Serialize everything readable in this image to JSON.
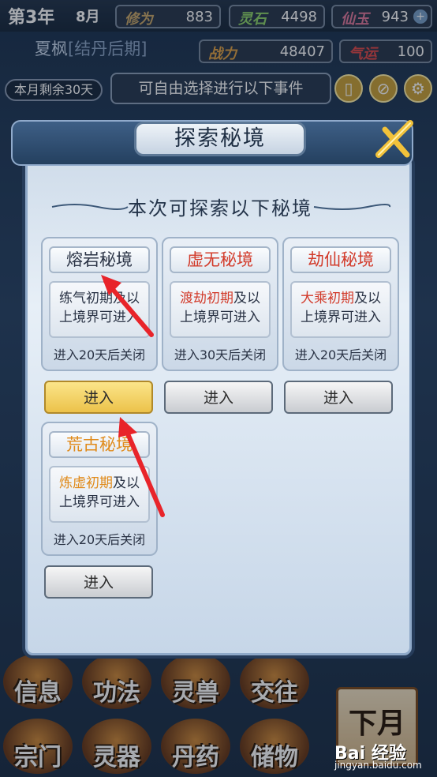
{
  "status": {
    "year": "第3年",
    "month": "8月",
    "cultivation": {
      "label": "修为",
      "value": "883",
      "color": "#c9a86a"
    },
    "spirit_stone": {
      "label": "灵石",
      "value": "4498",
      "color": "#8fd46a"
    },
    "jade": {
      "label": "仙玉",
      "value": "943",
      "color": "#e07a9c"
    },
    "power": {
      "label": "战力",
      "value": "48407",
      "color": "#e0a246"
    },
    "luck": {
      "label": "气运",
      "value": "100",
      "color": "#e04a4a"
    }
  },
  "player": {
    "name": "夏枫",
    "realm": "结丹后期"
  },
  "days_left": "本月剩余30天",
  "event_hint": "可自由选择进行以下事件",
  "dialog": {
    "title": "探索秘境",
    "subtitle": "本次可探索以下秘境",
    "realms": [
      {
        "name": "熔岩秘境",
        "name_color": "#2a3345",
        "req_highlight": "",
        "req_plain": "练气初期及以上境界可进入",
        "close_note": "进入20天后关闭",
        "enter_label": "进入",
        "enter_style": "gold"
      },
      {
        "name": "虚无秘境",
        "name_color": "#d23b2b",
        "req_highlight": "渡劫初期",
        "req_rest": "及以上境界可进入",
        "highlight_color": "#d23b2b",
        "close_note": "进入30天后关闭",
        "enter_label": "进入",
        "enter_style": "gray"
      },
      {
        "name": "劫仙秘境",
        "name_color": "#d23b2b",
        "req_highlight": "大乘初期",
        "req_rest": "及以上境界可进入",
        "highlight_color": "#d23b2b",
        "close_note": "进入20天后关闭",
        "enter_label": "进入",
        "enter_style": "gray"
      },
      {
        "name": "荒古秘境",
        "name_color": "#e08a1a",
        "req_highlight": "炼虚初期",
        "req_rest": "及以上境界可进入",
        "highlight_color": "#e08a1a",
        "close_note": "进入20天后关闭",
        "enter_label": "进入",
        "enter_style": "gray"
      }
    ]
  },
  "bottom_menu": [
    "信息",
    "功法",
    "灵兽",
    "交往",
    "宗门",
    "灵器",
    "丹药",
    "储物"
  ],
  "next_month": "下月",
  "watermark": {
    "brand": "Bai 经验",
    "url": "jingyan.baidu.com"
  },
  "icons": [
    "bag-icon",
    "map-icon",
    "gear-icon",
    "close-icon",
    "red-arrow-annotation"
  ]
}
